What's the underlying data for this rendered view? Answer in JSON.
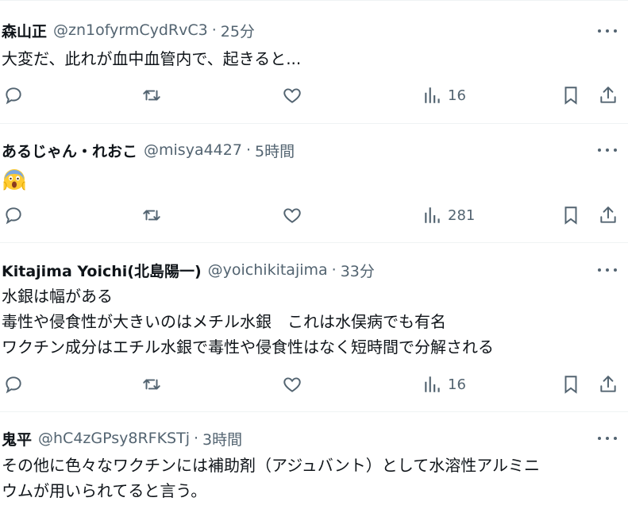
{
  "tweets": [
    {
      "name": "森山正",
      "handle": "@zn1ofyrmCydRvC3",
      "time": "25分",
      "lines": [
        "大変だ、此れが血中血管内で、起きると..."
      ],
      "views": "16"
    },
    {
      "name": "あるじゃん・れおこ",
      "handle": "@misya4427",
      "time": "5時間",
      "emoji": "face-screaming-in-fear",
      "views": "281"
    },
    {
      "name": "Kitajima Yoichi(北島陽一)",
      "handle": "@yoichikitajima",
      "time": "33分",
      "lines": [
        "水銀は幅がある",
        "毒性や侵食性が大きいのはメチル水銀　これは水俣病でも有名",
        "ワクチン成分はエチル水銀で毒性や侵食性はなく短時間で分解される"
      ],
      "views": "16"
    },
    {
      "name": "鬼平",
      "handle": "@hC4zGPsy8RFKSTj",
      "time": "3時間",
      "lines": [
        "その他に色々なワクチンには補助剤（アジュバント）として水溶性アルミニ",
        "ウムが用いられてると言う。"
      ]
    }
  ],
  "separator": "·",
  "icons": {
    "more": "more-icon",
    "reply": "reply-icon",
    "retweet": "retweet-icon",
    "like": "like-icon",
    "views": "views-icon",
    "bookmark": "bookmark-icon",
    "share": "share-icon"
  },
  "colors": {
    "text": "#0f1419",
    "secondary": "#536471",
    "divider": "#eff3f4"
  }
}
